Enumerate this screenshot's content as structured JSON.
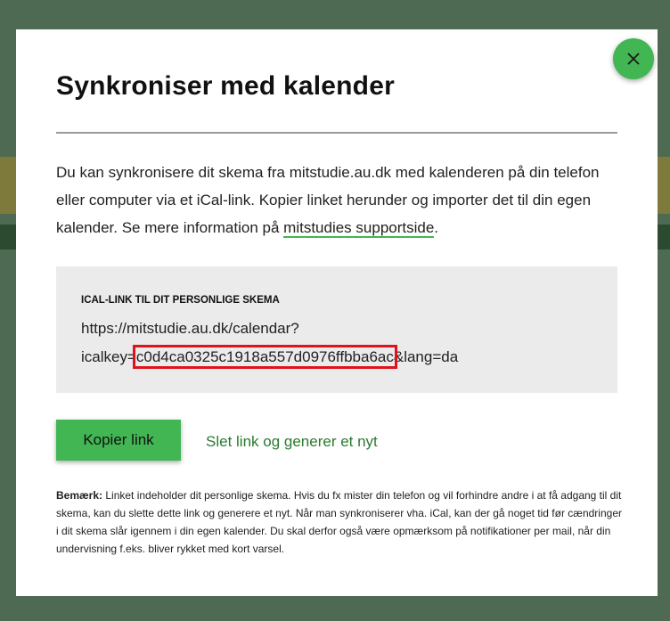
{
  "dialog": {
    "title": "Synkroniser med kalender",
    "intro_text": "Du kan synkronisere dit skema fra mitstudie.au.dk med kalenderen på din telefon eller computer via et iCal-link. Kopier linket herunder og importer det til din egen kalender. Se mere information på ",
    "support_link": "mitstudies supportside",
    "intro_end": ".",
    "close_icon": "close-icon"
  },
  "ical": {
    "heading": "ICAL-LINK TIL DIT PERSONLIGE SKEMA",
    "url_line1": "https://mitstudie.au.dk/calendar?",
    "url_prefix": "icalkey=",
    "icalkey": "c0d4ca0325c1918a557d0976ffbba6ac",
    "url_suffix": "&lang=da"
  },
  "actions": {
    "copy_label": "Kopier link",
    "regenerate_label": "Slet link og generer et nyt"
  },
  "note": {
    "label": "Bemærk:",
    "text": " Linket indeholder dit personlige skema. Hvis du fx mister din telefon og vil forhindre andre i at få adgang til dit skema, kan du slette dette link og generere et nyt. Når man synkroniserer vha. iCal, kan der gå noget tid før cændringer i dit skema slår igennem i din egen kalender. Du skal derfor også være opmærksom på notifikationer per mail, når din undervisning f.eks. bliver rykket med kort varsel."
  },
  "colors": {
    "accent": "#41b653",
    "link_green": "#2b7a2f",
    "highlight_red": "#e0131b",
    "overlay": "#4f6a53"
  }
}
